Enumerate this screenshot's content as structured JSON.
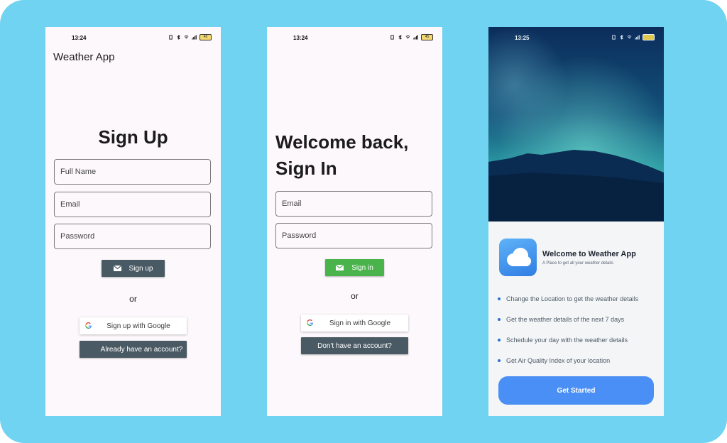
{
  "signup": {
    "status_time": "13:24",
    "battery": "45",
    "appbar_title": "Weather App",
    "heading": "Sign Up",
    "full_name_placeholder": "Full Name",
    "email_placeholder": "Email",
    "password_placeholder": "Password",
    "signup_button": "Sign up",
    "or": "or",
    "google_button": "Sign up with Google",
    "account_button": "Already have an account?"
  },
  "signin": {
    "status_time": "13:24",
    "battery": "45",
    "heading_line1": "Welcome back,",
    "heading_line2": "Sign In",
    "email_placeholder": "Email",
    "password_placeholder": "Password",
    "signin_button": "Sign in",
    "or": "or",
    "google_button": "Sign in with Google",
    "account_button": "Don't have an account?"
  },
  "welcome": {
    "status_time": "13:25",
    "title": "Welcome to Weather App",
    "subtitle": "A Place to get all your weather details",
    "features": [
      "Change the Location to get the weather details",
      "Get the weather details of the next 7 days",
      "Schedule your day with the weather details",
      "Get Air Quality Index of your location"
    ],
    "cta": "Get Started"
  },
  "colors": {
    "background": "#70d3f1",
    "dark_button": "#4a5a64",
    "green_button": "#4bb34c",
    "primary_blue": "#4a8ff5"
  },
  "icons": [
    "mail-icon",
    "google-icon",
    "cloud-icon",
    "wifi-icon",
    "bluetooth-icon",
    "signal-icon",
    "battery-icon"
  ]
}
